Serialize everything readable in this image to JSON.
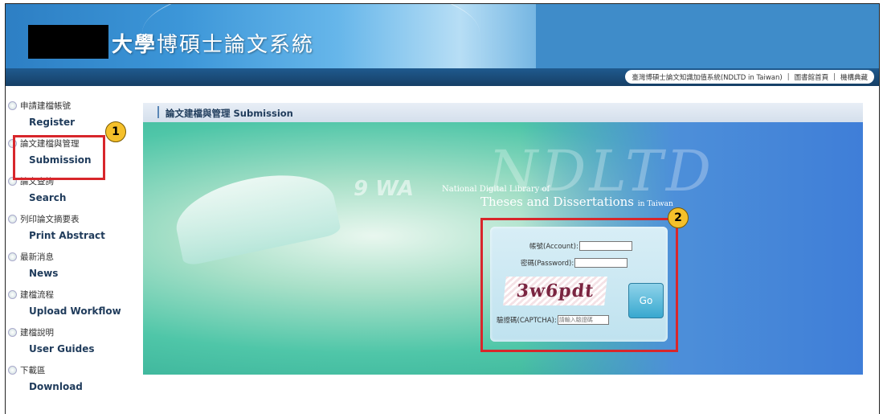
{
  "header": {
    "site_title_bold": "大學",
    "site_title_rest": "博碩士論文系統",
    "links": [
      "臺灣博碩士論文知識加值系統(NDLTD in Taiwan)",
      "圖書館首頁",
      "機構典藏"
    ]
  },
  "sidebar": {
    "items": [
      {
        "zh": "申請建檔帳號",
        "en": "Register"
      },
      {
        "zh": "論文建檔與管理",
        "en": "Submission"
      },
      {
        "zh": "論文查詢",
        "en": "Search"
      },
      {
        "zh": "列印論文摘要表",
        "en": "Print Abstract"
      },
      {
        "zh": "最新消息",
        "en": "News"
      },
      {
        "zh": "建檔流程",
        "en": "Upload Workflow"
      },
      {
        "zh": "建檔說明",
        "en": "User Guides"
      },
      {
        "zh": "下載區",
        "en": "Download"
      }
    ]
  },
  "section": {
    "title": "論文建檔與管理 Submission"
  },
  "hero": {
    "line1": "National Digital Library of",
    "line2": "Theses and Dissertations",
    "line2_small": "in Taiwan",
    "watermark": "NDLTD",
    "letters": "9 WA"
  },
  "login": {
    "account_label": "帳號(Account):",
    "password_label": "密碼(Password):",
    "captcha_label": "驗證碼(CAPTCHA):",
    "captcha_placeholder": "請輸入驗證碼",
    "captcha_text": "3w6pdt",
    "go_label": "Go"
  },
  "annotations": {
    "badge1": "1",
    "badge2": "2"
  },
  "colors": {
    "highlight": "#d8262b",
    "badge": "#f5c02a",
    "nav": "#1f5a8e"
  }
}
